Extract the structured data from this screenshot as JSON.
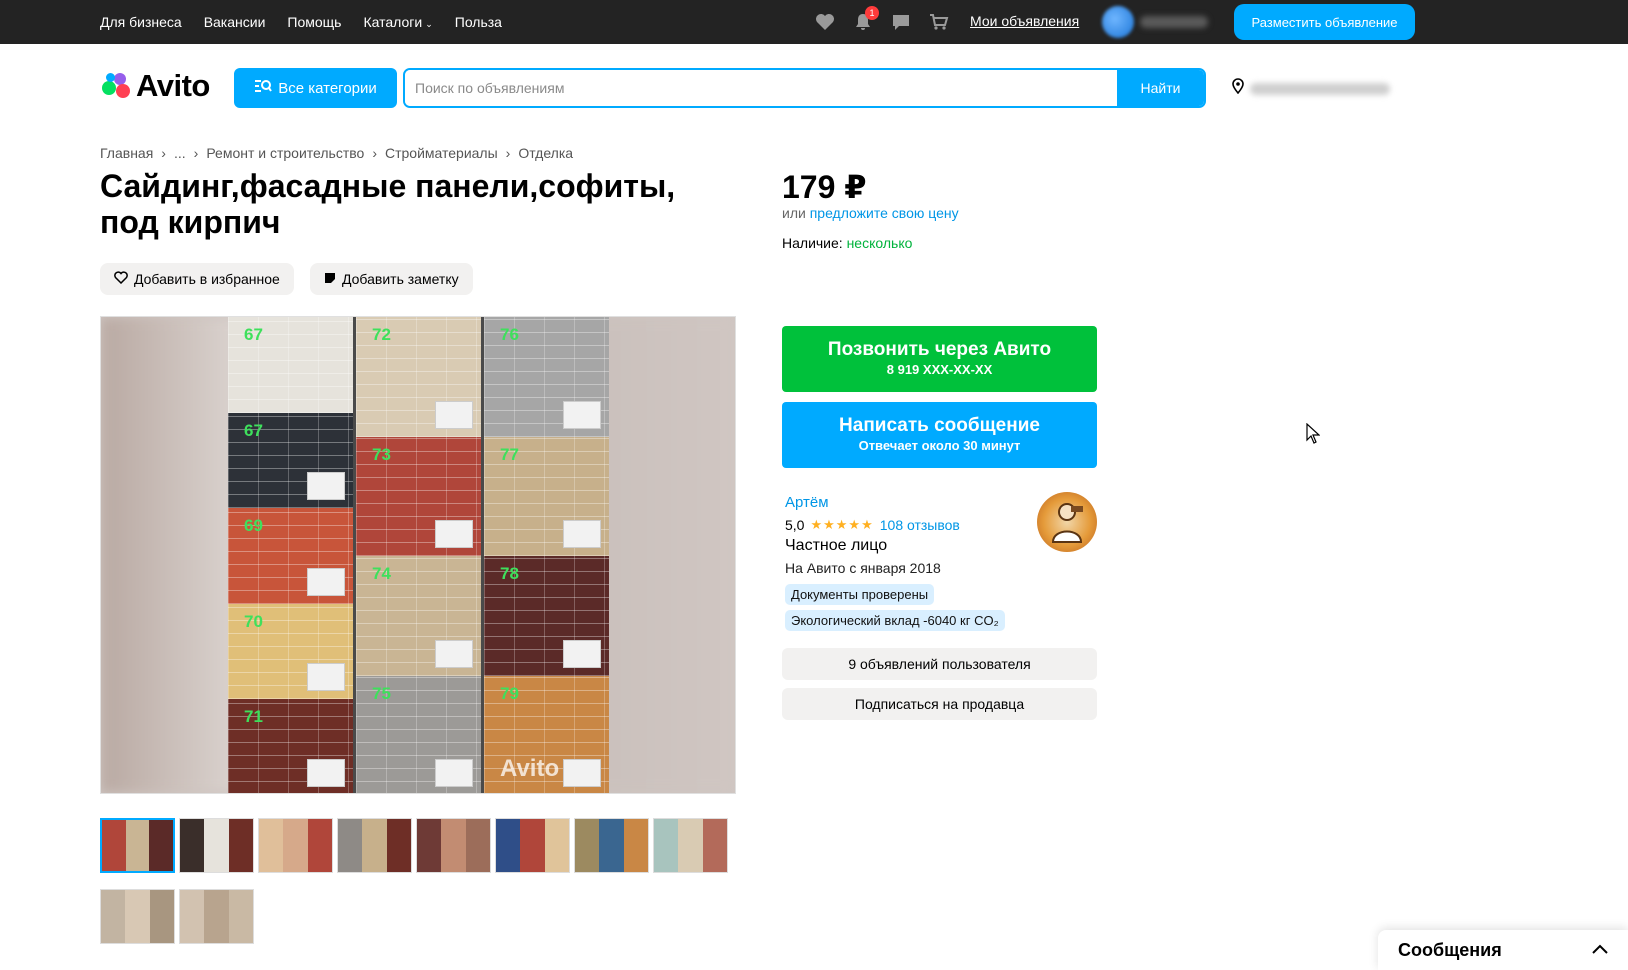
{
  "topbar": {
    "nav": [
      "Для бизнеса",
      "Вакансии",
      "Помощь",
      "Каталоги",
      "Польза"
    ],
    "icons": [
      "heart-icon",
      "bell-icon",
      "chat-icon",
      "cart-icon"
    ],
    "notifications_count": "1",
    "my_ads": "Мои объявления",
    "post_ad": "Разместить объявление"
  },
  "header": {
    "logo": "Avito",
    "all_categories": "Все категории",
    "search_placeholder": "Поиск по объявлениям",
    "search_button": "Найти"
  },
  "breadcrumb": [
    "Главная",
    "...",
    "Ремонт и строительство",
    "Стройматериалы",
    "Отделка"
  ],
  "listing": {
    "title": "Сайдинг,фасадные панели,софиты, под кирпич",
    "add_favorite": "Добавить в избранное",
    "add_note": "Добавить заметку",
    "price": "179 ₽",
    "price_or": "или",
    "price_offer": "предложите свою цену",
    "availability_label": "Наличие:",
    "availability_value": "несколько"
  },
  "gallery": {
    "watermark": "Avito",
    "panel_numbers": [
      "67",
      "67",
      "69",
      "70",
      "71",
      "72",
      "73",
      "74",
      "75",
      "76",
      "77",
      "78",
      "79"
    ]
  },
  "contact": {
    "call_title": "Позвонить через Авито",
    "call_phone": "8 919 XXX-XX-XX",
    "message_title": "Написать сообщение",
    "message_sub": "Отвечает около 30 минут"
  },
  "seller": {
    "name": "Артём",
    "rating": "5,0",
    "stars": "★★★★★",
    "reviews": "108 отзывов",
    "type": "Частное лицо",
    "since": "На Авито с января 2018",
    "badge_docs": "Документы проверены",
    "badge_eco": "Экологический вклад -6040 кг CO₂",
    "ads_count": "9 объявлений пользователя",
    "subscribe": "Подписаться на продавца"
  },
  "messenger": {
    "title": "Сообщения"
  },
  "colors": {
    "accent": "#00aaff",
    "call_green": "#00c13b",
    "link": "#0096e6",
    "availability": "#00b33c",
    "topbar": "#232323"
  }
}
